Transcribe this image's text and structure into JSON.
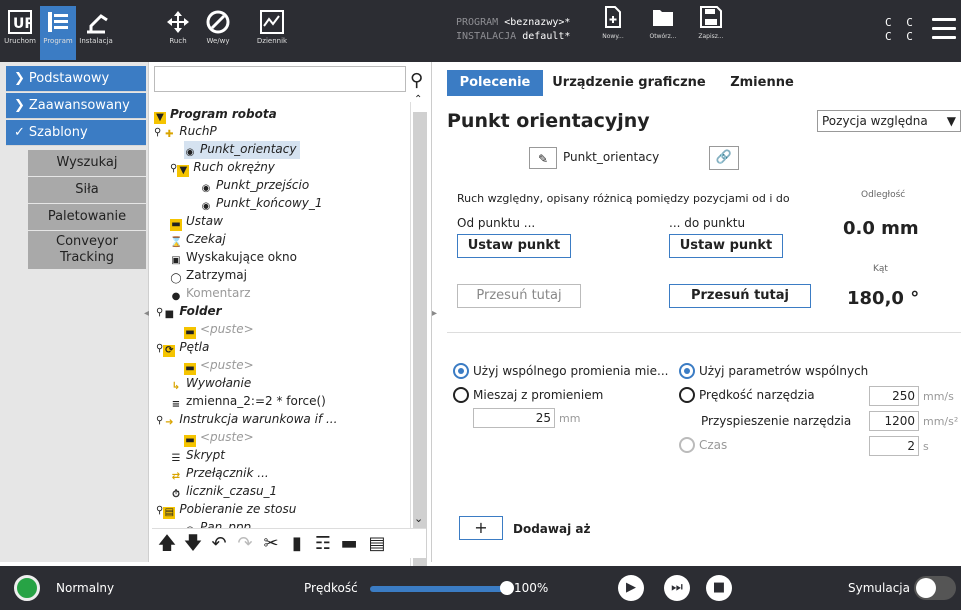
{
  "header": {
    "nav": [
      {
        "label": "Uruchom",
        "icon": "ur-logo-icon"
      },
      {
        "label": "Program",
        "icon": "program-icon"
      },
      {
        "label": "Instalacja",
        "icon": "robot-arm-icon"
      },
      {
        "label": "Ruch",
        "icon": "move-arrows-icon"
      },
      {
        "label": "We/wy",
        "icon": "io-icon"
      },
      {
        "label": "Dziennik",
        "icon": "log-icon"
      }
    ],
    "program_key": "PROGRAM",
    "program_value": "<beznazwy>*",
    "install_key": "INSTALACJA",
    "install_value": "default*",
    "file_buttons": [
      "Nowy...",
      "Otwórz...",
      "Zapisz..."
    ],
    "cc": [
      "C C",
      "C C"
    ]
  },
  "leftnav": {
    "items": [
      "Podstawowy",
      "Zaawansowany",
      "Szablony"
    ],
    "subitems": [
      "Wyszukaj",
      "Siła",
      "Paletowanie",
      "Conveyor Tracking"
    ]
  },
  "tree": {
    "search_value": "",
    "nodes": [
      "Program robota",
      "RuchP",
      "Punkt_orientacy",
      "Ruch okrężny",
      "Punkt_przejścio",
      "Punkt_końcowy_1",
      "Ustaw",
      "Czekaj",
      "Wyskakujące okno",
      "Zatrzymaj",
      "Komentarz",
      "Folder",
      "<puste>",
      "Pętla",
      "<puste>",
      "Wywołanie",
      "zmienna_2:=2 * force()",
      "Instrukcja warunkowa if ...",
      "<puste>",
      "Skrypt",
      "Przełącznik ...",
      "licznik_czasu_1",
      "Pobieranie ze stosu",
      "Pan_ppp"
    ]
  },
  "right": {
    "tabs": [
      "Polecenie",
      "Urządzenie graficzne",
      "Zmienne"
    ],
    "title": "Punkt orientacyjny",
    "dropdown": "Pozycja względna",
    "waypoint_name": "Punkt_orientacy",
    "description": "Ruch względny, opisany różnicą pomiędzy pozycjami od i do",
    "distance_label": "Odległość",
    "distance_value": "0.0 mm",
    "from_label": "Od punktu ...",
    "to_label": "... do punktu",
    "set_point": "Ustaw punkt",
    "move_here": "Przesuń tutaj",
    "angle_label": "Kąt",
    "angle_value": "180,0 °",
    "radius_shared": "Użyj wspólnego promienia mie...",
    "radius_blend": "Mieszaj z promieniem",
    "radius_value": "25",
    "radius_unit": "mm",
    "params_shared": "Użyj parametrów wspólnych",
    "tool_speed": "Prędkość narzędzia",
    "tool_speed_value": "250",
    "tool_speed_unit": "mm/s",
    "tool_accel": "Przyspieszenie narzędzia",
    "tool_accel_value": "1200",
    "tool_accel_unit": "mm/s²",
    "time_label": "Czas",
    "time_value": "2",
    "time_unit": "s",
    "add_until": "Dodawaj aż",
    "add_plus": "+"
  },
  "footer": {
    "status": "Normalny",
    "speed_label": "Prędkość",
    "speed_value": "100%",
    "speed_fraction": 1.0,
    "simulation": "Symulacja"
  },
  "colors": {
    "accent": "#3b7cc4",
    "header_bg": "#2c2d33",
    "status_green": "#27a345",
    "icon_yellow": "#f5c400"
  }
}
